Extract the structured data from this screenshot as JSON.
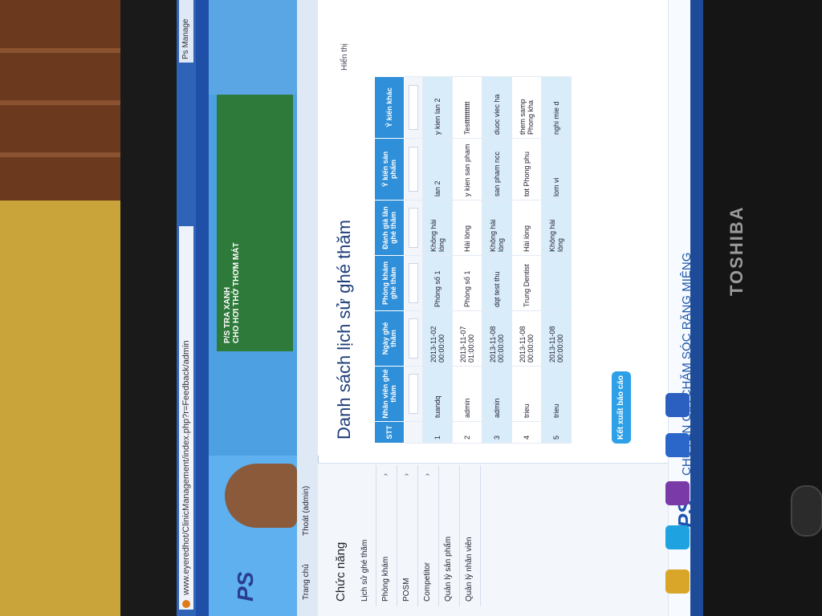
{
  "browser": {
    "url": "www.eyeredhot/ClinicManagement/index.php?r=Feedback/admin",
    "tab_title": "Ps Manage"
  },
  "banner": {
    "logo": "PS",
    "headline": "P/S TRA XANH",
    "sub": "CHO HƠI THỞ THƠM MÁT"
  },
  "nav": {
    "home": "Trang chủ",
    "logout": "Thoát (admin)"
  },
  "sidebar": {
    "title": "Chức năng",
    "items": [
      {
        "label": "Lịch sử ghé thăm",
        "arrow": ""
      },
      {
        "label": "Phòng khám",
        "arrow": "›"
      },
      {
        "label": "POSM",
        "arrow": "›"
      },
      {
        "label": "Competitor",
        "arrow": "›"
      },
      {
        "label": "Quản lý sản phẩm",
        "arrow": ""
      },
      {
        "label": "Quản lý nhân viên",
        "arrow": ""
      }
    ]
  },
  "main": {
    "title": "Danh sách lịch sử ghé thăm",
    "hint": "Hiển thị",
    "columns": [
      "STT",
      "Nhân viên ghé thăm",
      "Ngày ghé thăm",
      "Phòng khám ghé thăm",
      "Đánh giá lần ghé thăm",
      "Ý kiến sản phẩm",
      "Ý kiến khác"
    ],
    "rows": [
      [
        "1",
        "tuandq",
        "2013-11-02 00:00:00",
        "Phòng số 1",
        "Không hài lòng",
        "lan 2",
        "y kien lan 2"
      ],
      [
        "2",
        "admin",
        "2013-11-07 01:00:00",
        "Phòng số 1",
        "Hài lòng",
        "y kien san pham",
        "Testtttttttttt"
      ],
      [
        "3",
        "admin",
        "2013-11-08 00:00:00",
        "dqt test thu",
        "Không hài lòng",
        "san pham ncc",
        "duoc viec ha"
      ],
      [
        "4",
        "trieu",
        "2013-11-08 00:00:00",
        "Trung Dentist",
        "Hài lòng",
        "tot Phong phu",
        "them samp Phong kha"
      ],
      [
        "5",
        "trieu",
        "2013-11-08 00:00:00",
        "",
        "Không hài lòng",
        "lom vi",
        "nghi mie d"
      ]
    ],
    "export_label": "Kết xuất báo cáo"
  },
  "footer": {
    "logo": "PS",
    "slogan": "CHUYÊN GIA CHĂM SÓC RĂNG MIỆNG"
  },
  "monitor": {
    "brand": "TOSHIBA"
  }
}
